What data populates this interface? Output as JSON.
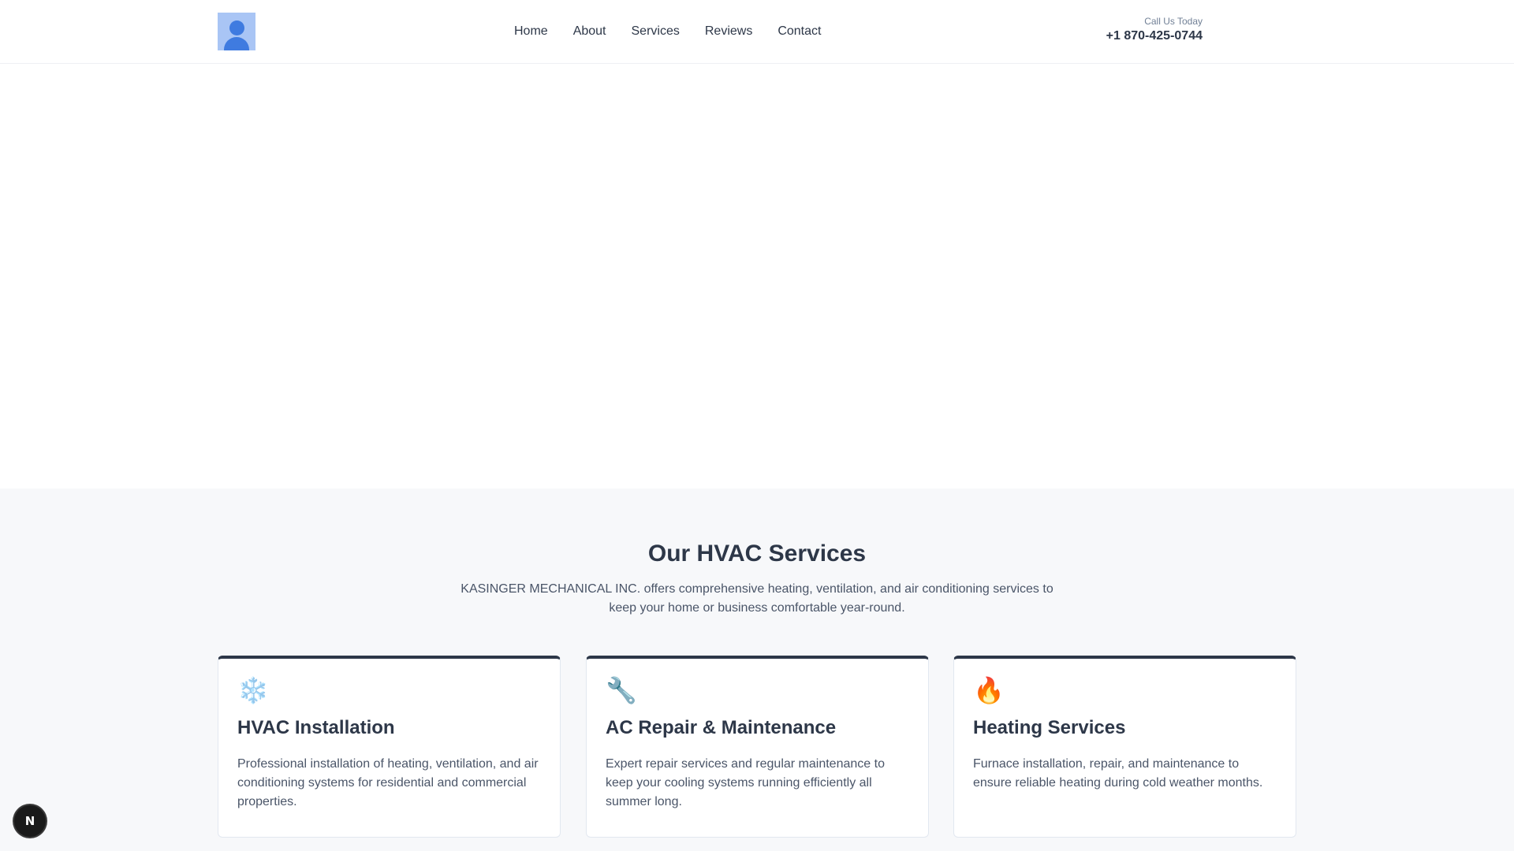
{
  "header": {
    "logo_icon": "user-avatar-icon",
    "nav": [
      "Home",
      "About",
      "Services",
      "Reviews",
      "Contact"
    ],
    "call_label": "Call Us Today",
    "phone": "+1 870-425-0744"
  },
  "services": {
    "title": "Our HVAC Services",
    "intro": "KASINGER MECHANICAL INC. offers comprehensive heating, ventilation, and air conditioning services to keep your home or business comfortable year-round.",
    "cards": [
      {
        "icon": "❄️",
        "icon_name": "snowflake-icon",
        "title": "HVAC Installation",
        "text": "Professional installation of heating, ventilation, and air conditioning systems for residential and commercial properties."
      },
      {
        "icon": "🔧",
        "icon_name": "wrench-icon",
        "title": "AC Repair & Maintenance",
        "text": "Expert repair services and regular maintenance to keep your cooling systems running efficiently all summer long."
      },
      {
        "icon": "🔥",
        "icon_name": "fire-icon",
        "title": "Heating Services",
        "text": "Furnace installation, repair, and maintenance to ensure reliable heating during cold weather months."
      }
    ]
  },
  "badge": {
    "label": "N"
  },
  "colors": {
    "accent": "#2d3748",
    "section_bg": "#f7f8fa",
    "logo_bg": "#a9c5f5",
    "logo_fg": "#3f7be0"
  }
}
